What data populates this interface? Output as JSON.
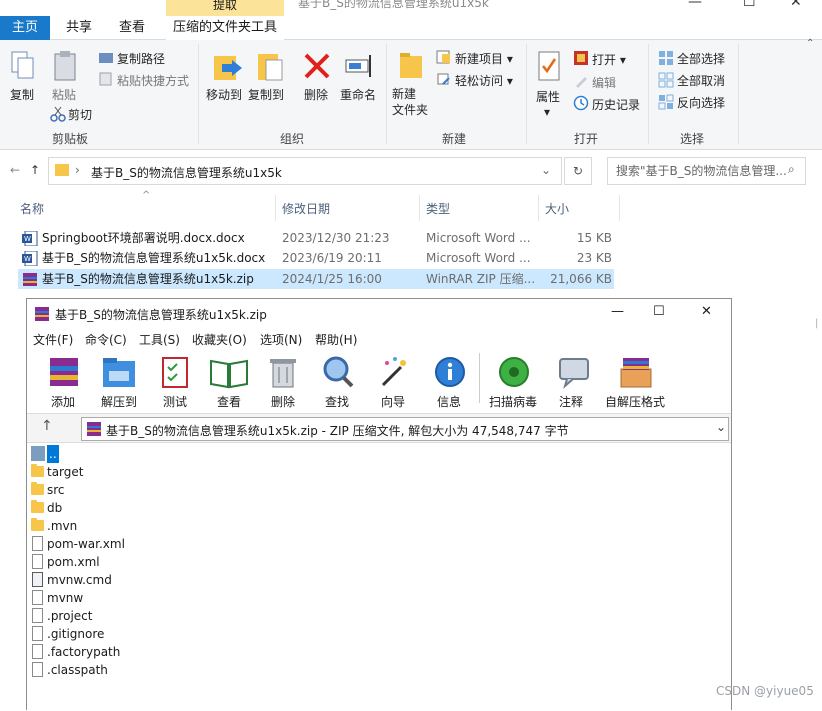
{
  "explorer": {
    "ctx_tab_label": "提取",
    "window_title": "基于B_S的物流信息管理系统u1x5k",
    "controls": {
      "minimize": "—",
      "maximize": "☐",
      "close": "✕"
    },
    "tabs": [
      {
        "label": "主页",
        "active": true
      },
      {
        "label": "共享"
      },
      {
        "label": "查看"
      },
      {
        "label": "压缩的文件夹工具"
      }
    ],
    "ribbon": {
      "clipboard": {
        "copy": "复制",
        "paste": "粘贴",
        "copy_path": "复制路径",
        "paste_shortcut": "粘贴快捷方式",
        "cut": "剪切",
        "group": "剪贴板"
      },
      "organize": {
        "move_to": "移动到",
        "copy_to": "复制到",
        "delete": "删除",
        "rename": "重命名",
        "group": "组织"
      },
      "new": {
        "new_folder": "新建\n文件夹",
        "new_item": "新建项目",
        "easy_access": "轻松访问",
        "group": "新建"
      },
      "open": {
        "properties": "属性",
        "open": "打开",
        "edit": "编辑",
        "history": "历史记录",
        "group": "打开"
      },
      "select": {
        "select_all": "全部选择",
        "select_none": "全部取消",
        "invert": "反向选择",
        "group": "选择"
      }
    },
    "address": {
      "path": "基于B_S的物流信息管理系统u1x5k",
      "search_placeholder": "搜索\"基于B_S的物流信息管理..."
    },
    "columns": {
      "name": "名称",
      "modified": "修改日期",
      "type": "类型",
      "size": "大小"
    },
    "files": [
      {
        "name": "Springboot环境部署说明.docx.docx",
        "modified": "2023/12/30 21:23",
        "type": "Microsoft Word ...",
        "size": "15 KB"
      },
      {
        "name": "基于B_S的物流信息管理系统u1x5k.docx",
        "modified": "2023/6/19 20:11",
        "type": "Microsoft Word ...",
        "size": "23 KB"
      },
      {
        "name": "基于B_S的物流信息管理系统u1x5k.zip",
        "modified": "2024/1/25 16:00",
        "type": "WinRAR ZIP 压缩...",
        "size": "21,066 KB",
        "selected": true
      }
    ]
  },
  "winrar": {
    "title": "基于B_S的物流信息管理系统u1x5k.zip",
    "controls": {
      "minimize": "—",
      "maximize": "☐",
      "close": "✕"
    },
    "menu": [
      "文件(F)",
      "命令(C)",
      "工具(S)",
      "收藏夹(O)",
      "选项(N)",
      "帮助(H)"
    ],
    "toolbar": [
      "添加",
      "解压到",
      "测试",
      "查看",
      "删除",
      "查找",
      "向导",
      "信息",
      "扫描病毒",
      "注释",
      "自解压格式"
    ],
    "path": "基于B_S的物流信息管理系统u1x5k.zip - ZIP 压缩文件, 解包大小为 47,548,747 字节",
    "items": [
      {
        "name": "..",
        "kind": "up"
      },
      {
        "name": "target",
        "kind": "folder"
      },
      {
        "name": "src",
        "kind": "folder"
      },
      {
        "name": "db",
        "kind": "folder"
      },
      {
        "name": ".mvn",
        "kind": "folder"
      },
      {
        "name": "pom-war.xml",
        "kind": "xml"
      },
      {
        "name": "pom.xml",
        "kind": "xml"
      },
      {
        "name": "mvnw.cmd",
        "kind": "cmd"
      },
      {
        "name": "mvnw",
        "kind": "file"
      },
      {
        "name": ".project",
        "kind": "file"
      },
      {
        "name": ".gitignore",
        "kind": "file"
      },
      {
        "name": ".factorypath",
        "kind": "file"
      },
      {
        "name": ".classpath",
        "kind": "file"
      }
    ]
  },
  "watermark": "CSDN @yiyue05"
}
